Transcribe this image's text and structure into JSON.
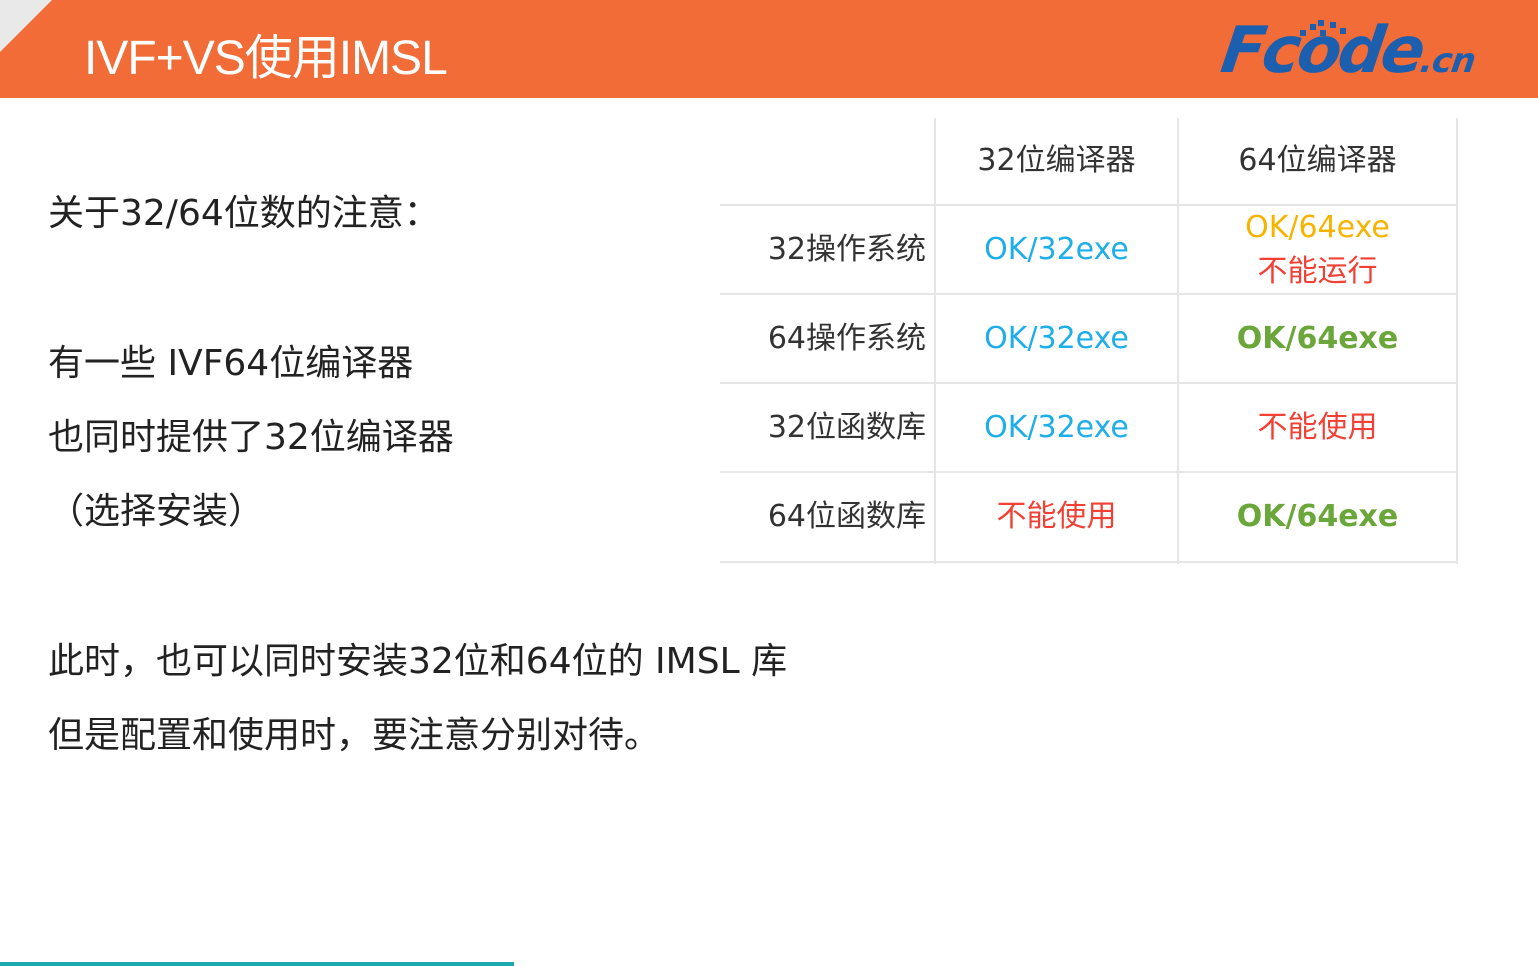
{
  "header": {
    "title": "IVF+VS使用IMSL",
    "logo": {
      "main": "Fcode",
      "suffix": ".cn"
    },
    "colors": {
      "bar": "#f26c38",
      "logo": "#1b5fae"
    }
  },
  "left": {
    "heading": "关于32/64位数的注意：",
    "lines": [
      "有一些 IVF64位编译器",
      "也同时提供了32位编译器",
      "（选择安装）"
    ]
  },
  "bottom": {
    "lines": [
      "此时，也可以同时安装32位和64位的 IMSL 库",
      "但是配置和使用时，要注意分别对待。"
    ]
  },
  "table": {
    "columns": [
      "32位编译器",
      "64位编译器"
    ],
    "rows": [
      {
        "label": "32操作系统",
        "c32": "OK/32exe",
        "c64": [
          "OK/64exe",
          "不能运行"
        ]
      },
      {
        "label": "64操作系统",
        "c32": "OK/32exe",
        "c64": "OK/64exe"
      },
      {
        "label": "32位函数库",
        "c32": "OK/32exe",
        "c64": "不能使用"
      },
      {
        "label": "64位函数库",
        "c32": "不能使用",
        "c64": "OK/64exe"
      }
    ],
    "colors": {
      "ok32": "#1eaee8",
      "ok64_warn": "#f6b400",
      "error": "#f24034",
      "ok64": "#6aa63a"
    }
  }
}
